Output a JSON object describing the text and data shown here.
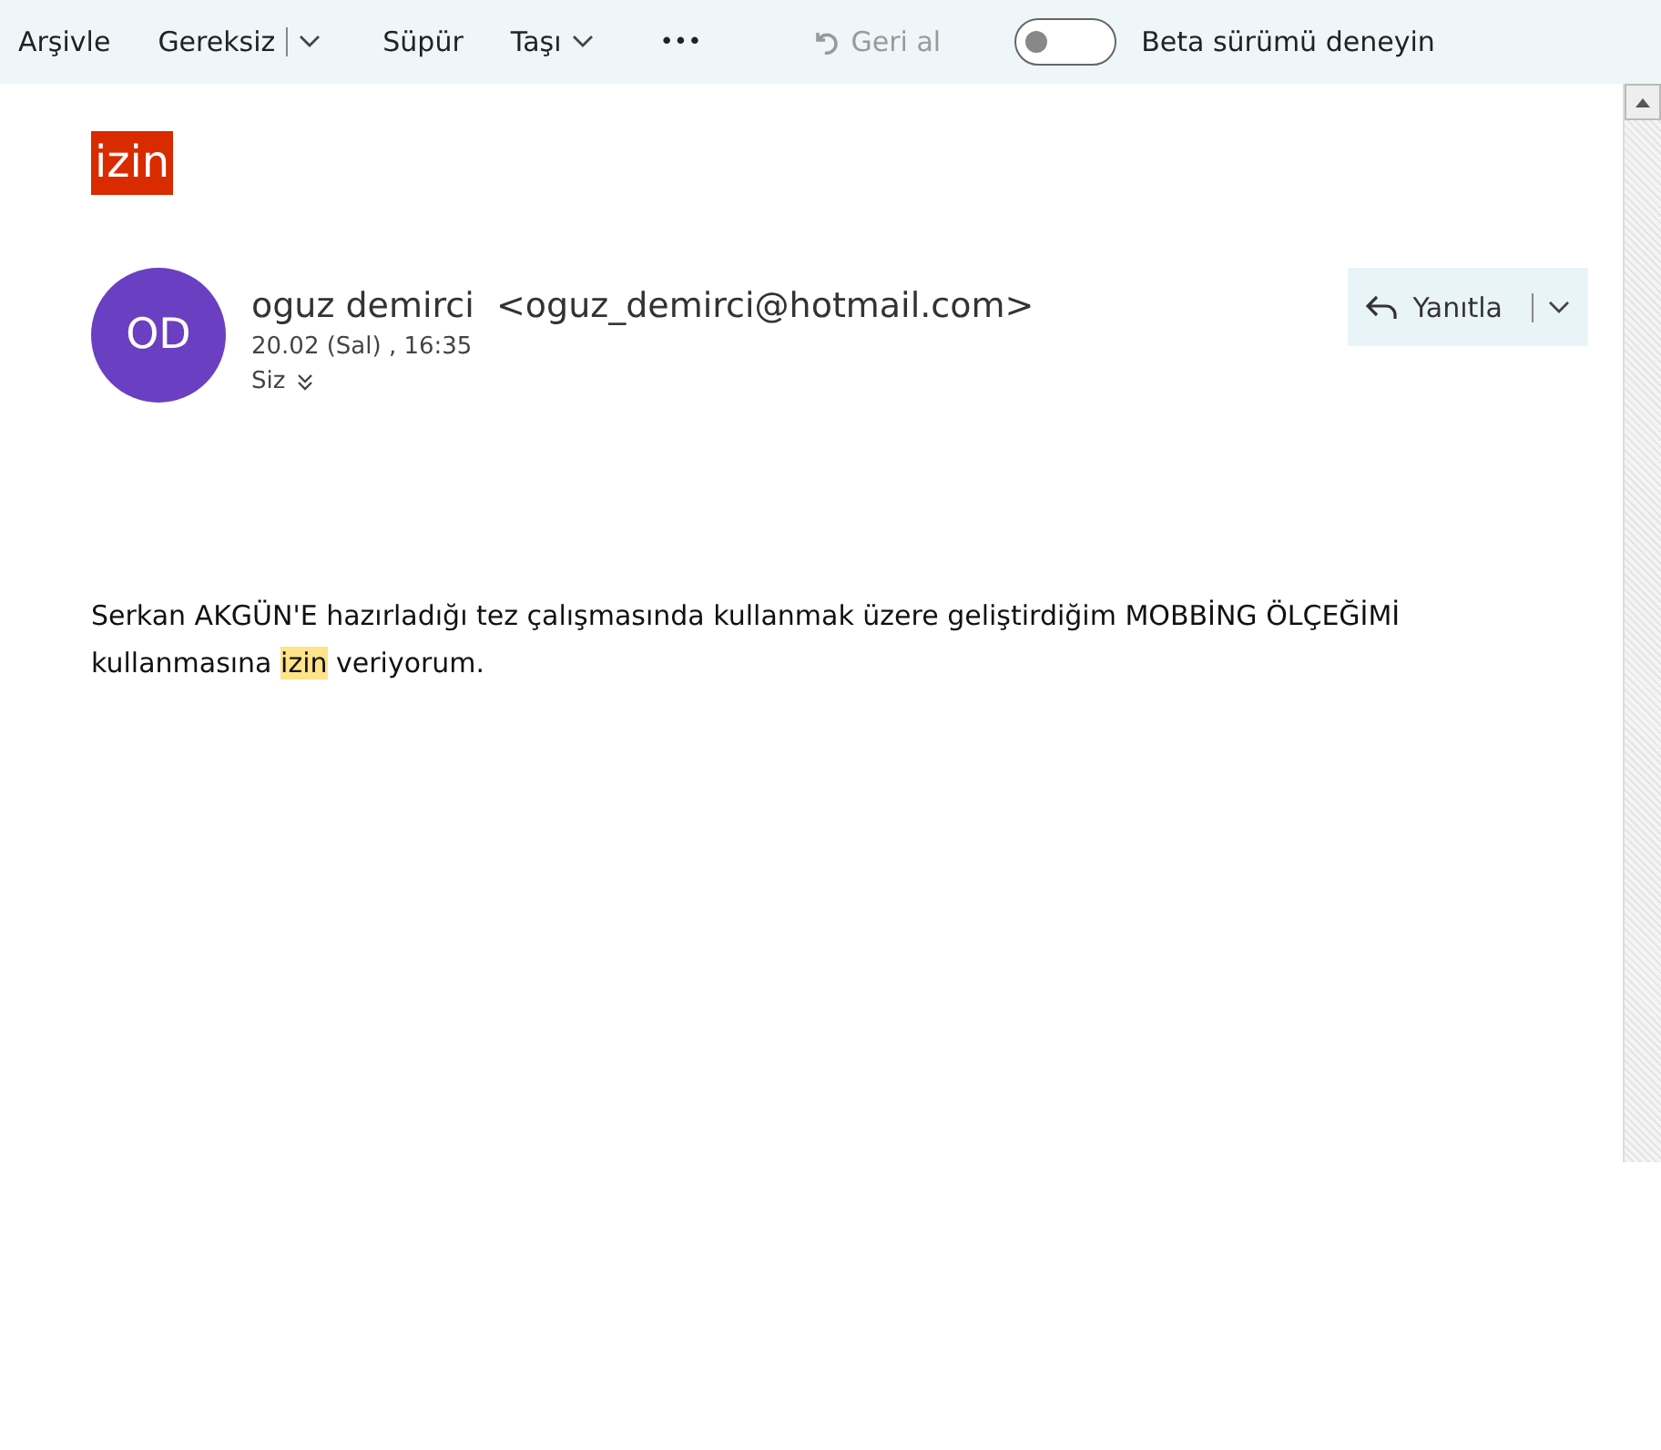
{
  "toolbar": {
    "items": [
      {
        "kind": "button",
        "label": "Arşivle"
      },
      {
        "kind": "split",
        "label": "Gereksiz"
      },
      {
        "kind": "button",
        "label": "Süpür"
      },
      {
        "kind": "menu",
        "label": "Taşı"
      },
      {
        "kind": "more",
        "label": "•••"
      },
      {
        "kind": "undo",
        "label": "Geri al",
        "disabled": true
      }
    ],
    "beta": {
      "label": "Beta sürümü deneyin",
      "on": false
    }
  },
  "message": {
    "subject": "izin",
    "sender": {
      "initials": "OD",
      "name": "oguz demirci",
      "email": "<oguz_demirci@hotmail.com>"
    },
    "date": "20.02 (Sal) , 16:35",
    "recipients": "Siz",
    "reply": {
      "label": "Yanıtla"
    },
    "body": {
      "before": "Serkan AKGÜN'E hazırladığı tez çalışmasında kullanmak üzere geliştirdiğim MOBBİNG ÖLÇEĞİMİ kullanmasına ",
      "highlight": "izin",
      "after": " veriyorum."
    }
  }
}
